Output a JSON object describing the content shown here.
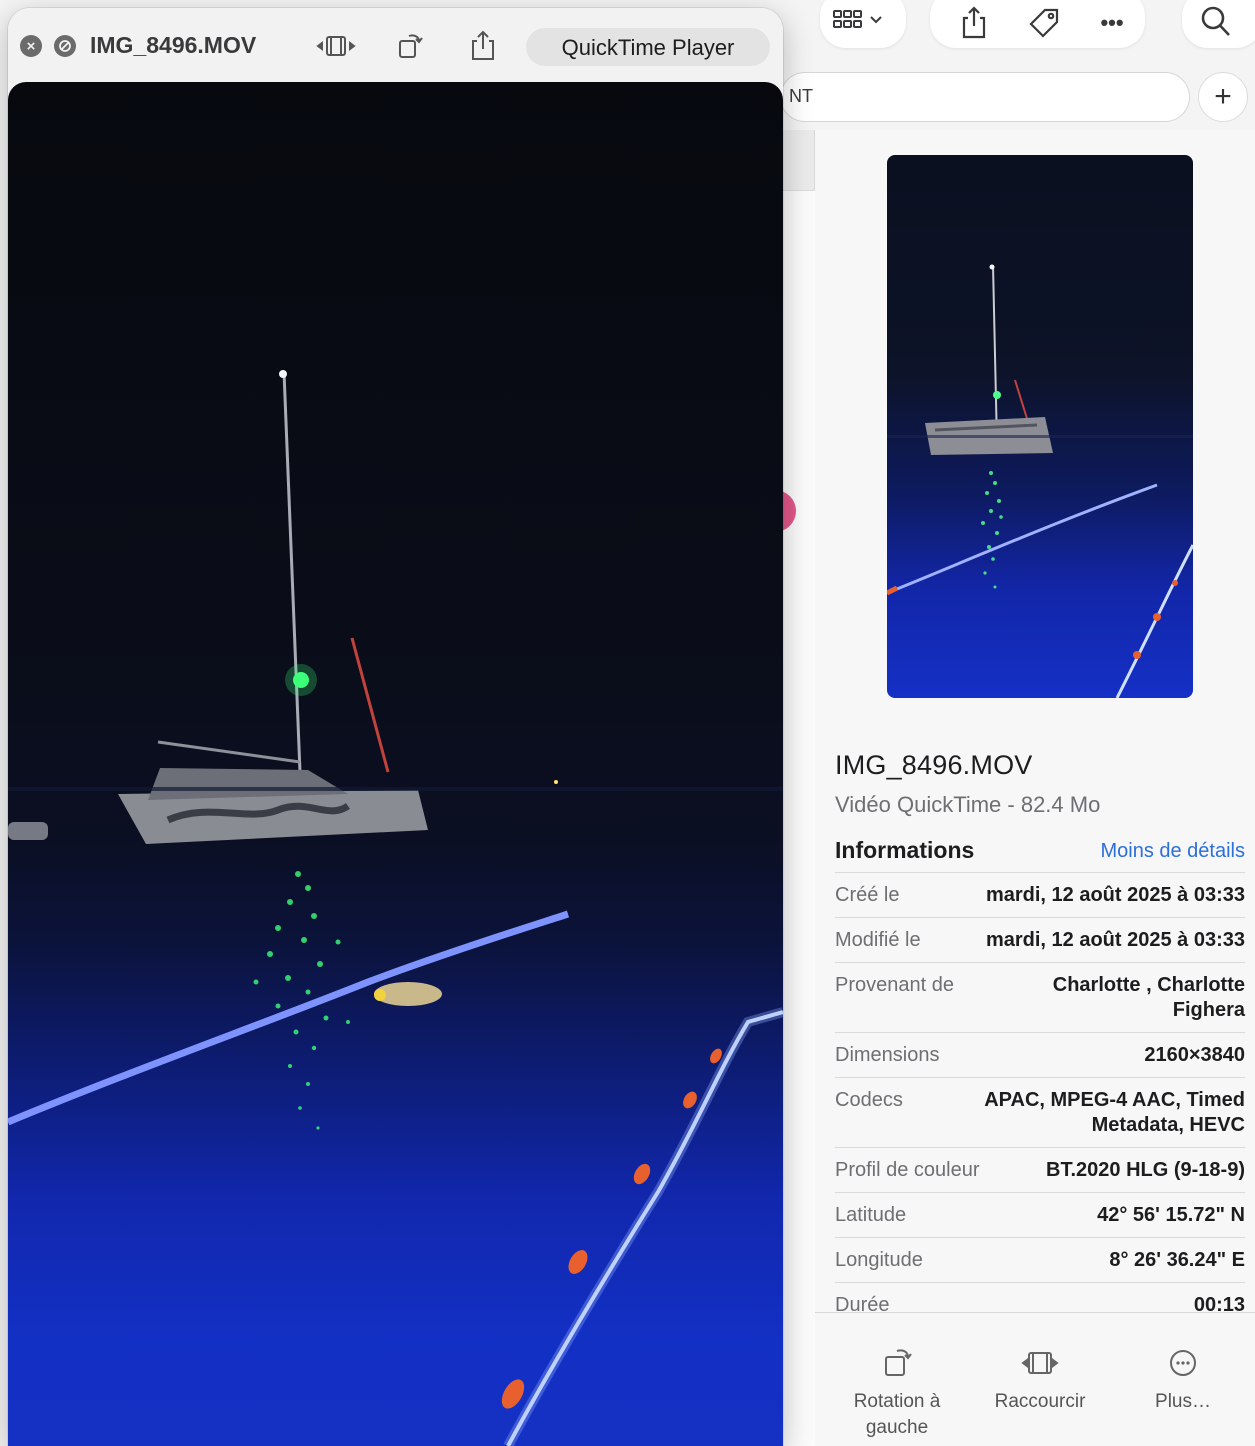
{
  "quicktime": {
    "window_title": "IMG_8496.MOV",
    "app_name": "QuickTime Player"
  },
  "finder": {
    "tag_field_text": "NT",
    "add_button": "+"
  },
  "info": {
    "file_name": "IMG_8496.MOV",
    "subtitle": "Vidéo QuickTime - 82.4 Mo",
    "section_title": "Informations",
    "less_details": "Moins de détails",
    "rows": [
      {
        "label": "Créé le",
        "value": "mardi, 12 août 2025 à 03:33"
      },
      {
        "label": "Modifié le",
        "value": "mardi, 12 août 2025 à 03:33"
      },
      {
        "label": "Provenant de",
        "value": "Charlotte , Charlotte Fighera"
      },
      {
        "label": "Dimensions",
        "value": "2160×3840"
      },
      {
        "label": "Codecs",
        "value": "APAC, MPEG-4 AAC, Timed Metadata, HEVC"
      },
      {
        "label": "Profil de couleur",
        "value": "BT.2020 HLG (9-18-9)"
      },
      {
        "label": "Latitude",
        "value": "42° 56' 15.72\" N"
      },
      {
        "label": "Longitude",
        "value": "8° 26' 36.24\" E"
      },
      {
        "label": "Durée",
        "value": "00:13"
      }
    ],
    "actions": [
      {
        "label": "Rotation à gauche",
        "icon": "rotate-left-icon"
      },
      {
        "label": "Raccourcir",
        "icon": "trim-icon"
      },
      {
        "label": "Plus…",
        "icon": "more-circle-icon"
      }
    ]
  },
  "colors": {
    "accent_link": "#2c6fdb",
    "water_blue": "#1530c6",
    "night_sky": "#0a0d18",
    "mast_light_green": "#3cff7a",
    "buoy_orange": "#e8602e"
  }
}
